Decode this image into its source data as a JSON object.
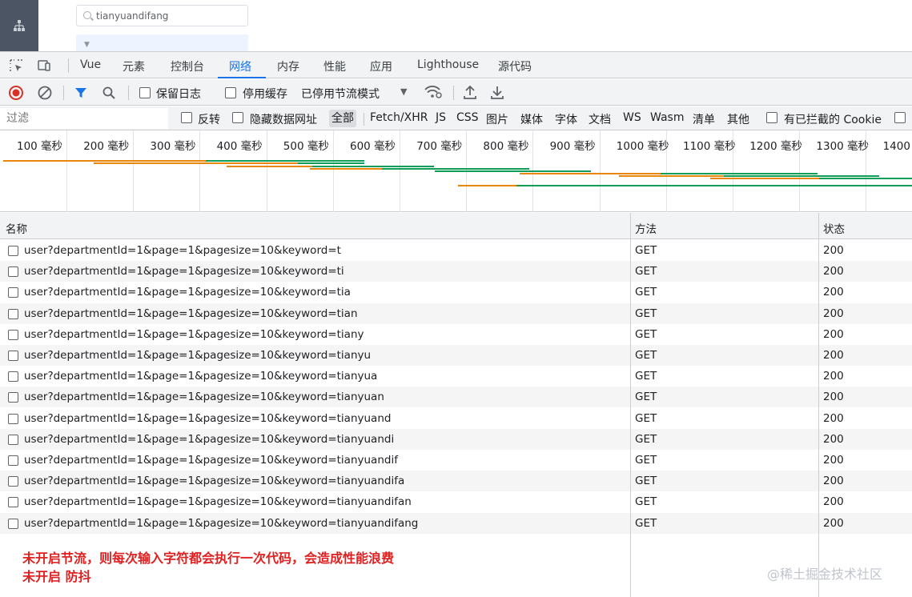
{
  "app": {
    "search_value": "tianyuandifang"
  },
  "devtools": {
    "tabs": [
      {
        "label": "Vue",
        "active": false
      },
      {
        "label": "元素",
        "active": false
      },
      {
        "label": "控制台",
        "active": false
      },
      {
        "label": "网络",
        "active": true
      },
      {
        "label": "内存",
        "active": false
      },
      {
        "label": "性能",
        "active": false
      },
      {
        "label": "应用",
        "active": false
      },
      {
        "label": "Lighthouse",
        "active": false
      },
      {
        "label": "源代码",
        "active": false
      }
    ],
    "toolbar": {
      "preserve_log": "保留日志",
      "disable_cache": "停用缓存",
      "throttling": "已停用节流模式"
    },
    "filter": {
      "placeholder": "过滤",
      "invert": "反转",
      "hide_data_urls": "隐藏数据网址",
      "types": [
        "全部",
        "Fetch/XHR",
        "JS",
        "CSS",
        "图片",
        "媒体",
        "字体",
        "文档",
        "WS",
        "Wasm",
        "清单",
        "其他"
      ],
      "selected_type": "全部",
      "blocked_cookies": "有已拦截的 Cookie"
    },
    "timeline": {
      "labels": [
        "100 毫秒",
        "200 毫秒",
        "300 毫秒",
        "400 毫秒",
        "500 毫秒",
        "600 毫秒",
        "700 毫秒",
        "800 毫秒",
        "900 毫秒",
        "1000 毫秒",
        "1100 毫秒",
        "1200 毫秒",
        "1300 毫秒",
        "1400 毫秒"
      ],
      "colors": {
        "waiting": "#e8870c",
        "download": "#0f9d58"
      }
    },
    "table": {
      "headers": {
        "name": "名称",
        "method": "方法",
        "status": "状态"
      },
      "rows": [
        {
          "name": "user?departmentId=1&page=1&pagesize=10&keyword=t",
          "method": "GET",
          "status": "200"
        },
        {
          "name": "user?departmentId=1&page=1&pagesize=10&keyword=ti",
          "method": "GET",
          "status": "200"
        },
        {
          "name": "user?departmentId=1&page=1&pagesize=10&keyword=tia",
          "method": "GET",
          "status": "200"
        },
        {
          "name": "user?departmentId=1&page=1&pagesize=10&keyword=tian",
          "method": "GET",
          "status": "200"
        },
        {
          "name": "user?departmentId=1&page=1&pagesize=10&keyword=tiany",
          "method": "GET",
          "status": "200"
        },
        {
          "name": "user?departmentId=1&page=1&pagesize=10&keyword=tianyu",
          "method": "GET",
          "status": "200"
        },
        {
          "name": "user?departmentId=1&page=1&pagesize=10&keyword=tianyua",
          "method": "GET",
          "status": "200"
        },
        {
          "name": "user?departmentId=1&page=1&pagesize=10&keyword=tianyuan",
          "method": "GET",
          "status": "200"
        },
        {
          "name": "user?departmentId=1&page=1&pagesize=10&keyword=tianyuand",
          "method": "GET",
          "status": "200"
        },
        {
          "name": "user?departmentId=1&page=1&pagesize=10&keyword=tianyuandi",
          "method": "GET",
          "status": "200"
        },
        {
          "name": "user?departmentId=1&page=1&pagesize=10&keyword=tianyuandif",
          "method": "GET",
          "status": "200"
        },
        {
          "name": "user?departmentId=1&page=1&pagesize=10&keyword=tianyuandifa",
          "method": "GET",
          "status": "200"
        },
        {
          "name": "user?departmentId=1&page=1&pagesize=10&keyword=tianyuandifan",
          "method": "GET",
          "status": "200"
        },
        {
          "name": "user?departmentId=1&page=1&pagesize=10&keyword=tianyuandifang",
          "method": "GET",
          "status": "200"
        }
      ]
    }
  },
  "annotation": {
    "line1": "未开启节流，则每次输入字符都会执行一次代码，会造成性能浪费",
    "line2": "未开启 防抖",
    "color": "#e02020"
  },
  "watermark": "@稀土掘金技术社区"
}
